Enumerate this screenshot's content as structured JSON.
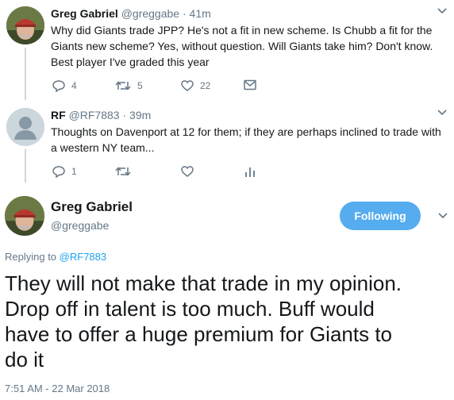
{
  "tweet1": {
    "name": "Greg Gabriel",
    "handle": "@greggabe",
    "time": "41m",
    "text_lines": [
      "Why did Giants trade JPP? He's not a fit in new scheme. Is Chubb a fit for the",
      "Giants new scheme? Yes, without question. Will Giants take him? Don't know.",
      "Best player I've graded this year"
    ],
    "reply_count": "4",
    "retweet_count": "5",
    "like_count": "22"
  },
  "tweet2": {
    "name": "RF",
    "handle": "@RF7883",
    "time": "39m",
    "text_lines": [
      "Thoughts on Davenport at 12 for them; if they are perhaps inclined to trade with",
      "a western NY team..."
    ],
    "reply_count": "1"
  },
  "main": {
    "name": "Greg Gabriel",
    "handle": "@greggabe",
    "follow_label": "Following",
    "replying_prefix": "Replying to",
    "replying_to": "@RF7883",
    "text_lines": [
      "They will not make that trade in my opinion.",
      "Drop off in talent is too much. Buff would",
      "have to offer a huge premium for Giants to",
      "do it"
    ],
    "timestamp": "7:51 AM - 22 Mar 2018"
  },
  "ui": {
    "dot": " · ",
    "chevron": "⌄"
  },
  "colors": {
    "accent": "#1da1f2",
    "follow_bg": "#55acee",
    "muted": "#657786",
    "thread_line": "#ccd6dd"
  }
}
